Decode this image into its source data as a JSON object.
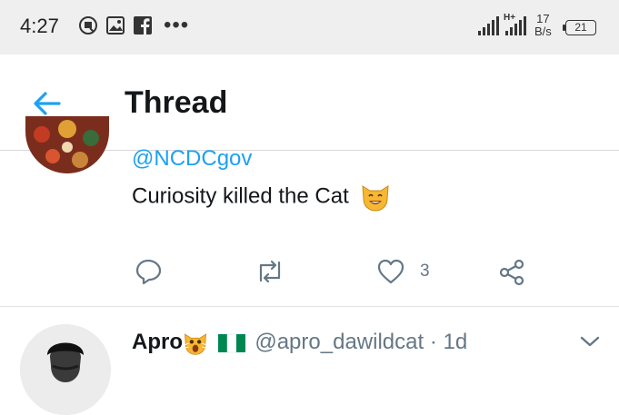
{
  "status_bar": {
    "time": "4:27",
    "network_type": "H+",
    "speed_value": "17",
    "speed_unit": "B/s",
    "battery": "21",
    "more_indicator": "•••"
  },
  "header": {
    "title": "Thread"
  },
  "tweet": {
    "mention": "@NCDCgov",
    "text": "Curiosity killed the Cat",
    "like_count": "3"
  },
  "reply": {
    "author_name": "Apro",
    "author_handle_and_time": "@apro_dawildcat · 1d"
  },
  "colors": {
    "accent": "#1da1f2",
    "muted": "#657786"
  }
}
